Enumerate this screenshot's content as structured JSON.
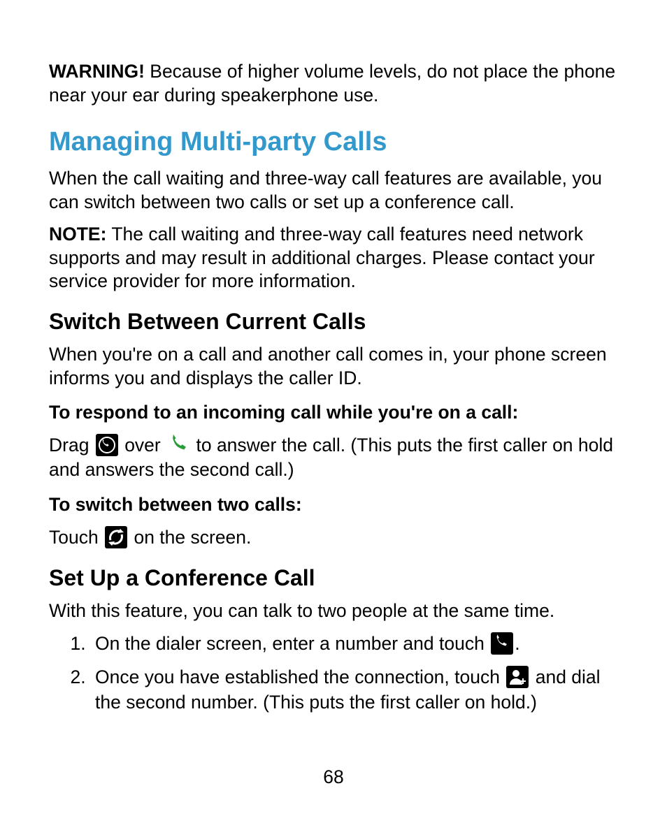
{
  "warning": {
    "label": "WARNING!",
    "text": " Because of higher volume levels, do not place the phone near your ear during speakerphone use."
  },
  "heading_main": "Managing Multi-party Calls",
  "intro_para": "When the call waiting and three-way call features are available, you can switch between two calls or set up a conference call.",
  "note": {
    "label": "NOTE:",
    "text": " The call waiting and three-way call features need network supports and may result in additional charges. Please contact your service provider for more information."
  },
  "section_switch": {
    "heading": "Switch Between Current Calls",
    "intro": "When you're on a call and another call comes in, your phone screen informs you and displays the caller ID.",
    "respond_heading": "To respond to an incoming call while you're on a call:",
    "drag_before": "Drag ",
    "drag_mid": " over ",
    "drag_after": " to answer the call. (This puts the first caller on hold and answers the second call.)",
    "switch_heading": "To switch between two calls:",
    "touch_before": "Touch ",
    "touch_after": " on the screen."
  },
  "section_conf": {
    "heading": "Set Up a Conference Call",
    "intro": "With this feature, you can talk to two people at the same time.",
    "step1_before": "On the dialer screen, enter a number and touch ",
    "step1_after": ".",
    "step2_before": "Once you have established the connection, touch ",
    "step2_after": " and dial the second number. (This puts the first caller on hold.)"
  },
  "page_number": "68",
  "icons": {
    "ring_phone": "ring-phone-icon",
    "green_phone": "green-phone-icon",
    "swap": "swap-calls-icon",
    "dial_phone": "dial-phone-icon",
    "add_person": "add-person-icon"
  }
}
